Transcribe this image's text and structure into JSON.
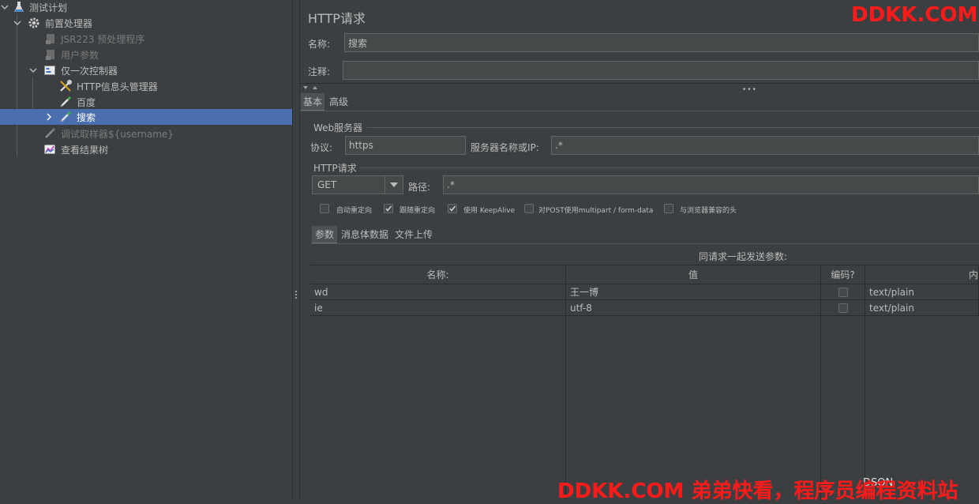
{
  "tree": {
    "items": [
      {
        "label": "测试计划",
        "icon": "flask-icon"
      },
      {
        "label": "前置处理器",
        "icon": "gear-icon"
      },
      {
        "label": "JSR223 预处理程序",
        "icon": "script-icon"
      },
      {
        "label": "用户参数",
        "icon": "script-icon"
      },
      {
        "label": "仅一次控制器",
        "icon": "controller-icon"
      },
      {
        "label": "HTTP信息头管理器",
        "icon": "wrench-icon"
      },
      {
        "label": "百度",
        "icon": "pipette-icon"
      },
      {
        "label": "搜索",
        "icon": "pipette-icon"
      },
      {
        "label": "调试取样器${username}",
        "icon": "pipette-icon"
      },
      {
        "label": "查看结果树",
        "icon": "chart-icon"
      }
    ]
  },
  "panel": {
    "title": "HTTP请求",
    "name_label": "名称:",
    "name_value": "搜索",
    "comment_label": "注释:",
    "comment_value": "",
    "tabs": [
      "基本",
      "高级"
    ],
    "web_server": {
      "group_label": "Web服务器",
      "protocol_label": "协议:",
      "protocol_value": "https",
      "server_label": "服务器名称或IP:",
      "server_value": ".*"
    },
    "http_request": {
      "group_label": "HTTP请求",
      "method_value": "GET",
      "path_label": "路径:",
      "path_value": ".*"
    },
    "options": [
      {
        "label": "自动重定向",
        "checked": false
      },
      {
        "label": "跟随重定向",
        "checked": true
      },
      {
        "label": "使用 KeepAlive",
        "checked": true
      },
      {
        "label": "对POST使用multipart / form-data",
        "checked": false
      },
      {
        "label": "与浏览器兼容的头",
        "checked": false
      }
    ],
    "sub_tabs": [
      "参数",
      "消息体数据",
      "文件上传"
    ],
    "params_title": "同请求一起发送参数:",
    "params_headers": [
      "名称:",
      "值",
      "编码?",
      "内"
    ],
    "params_rows": [
      {
        "name": "wd",
        "value": "王一博",
        "encode": false,
        "content_type": "text/plain"
      },
      {
        "name": "ie",
        "value": "utf-8",
        "encode": false,
        "content_type": "text/plain"
      }
    ]
  },
  "watermarks": {
    "top": "DDKK.COM",
    "bottom": "DDKK.COM 弟弟快看，程序员编程资料站",
    "bottom_hidden": "DSON"
  },
  "colors": {
    "background": "#3c3f41",
    "selection": "#4b6eaf",
    "watermark": "#ff1a1a"
  }
}
